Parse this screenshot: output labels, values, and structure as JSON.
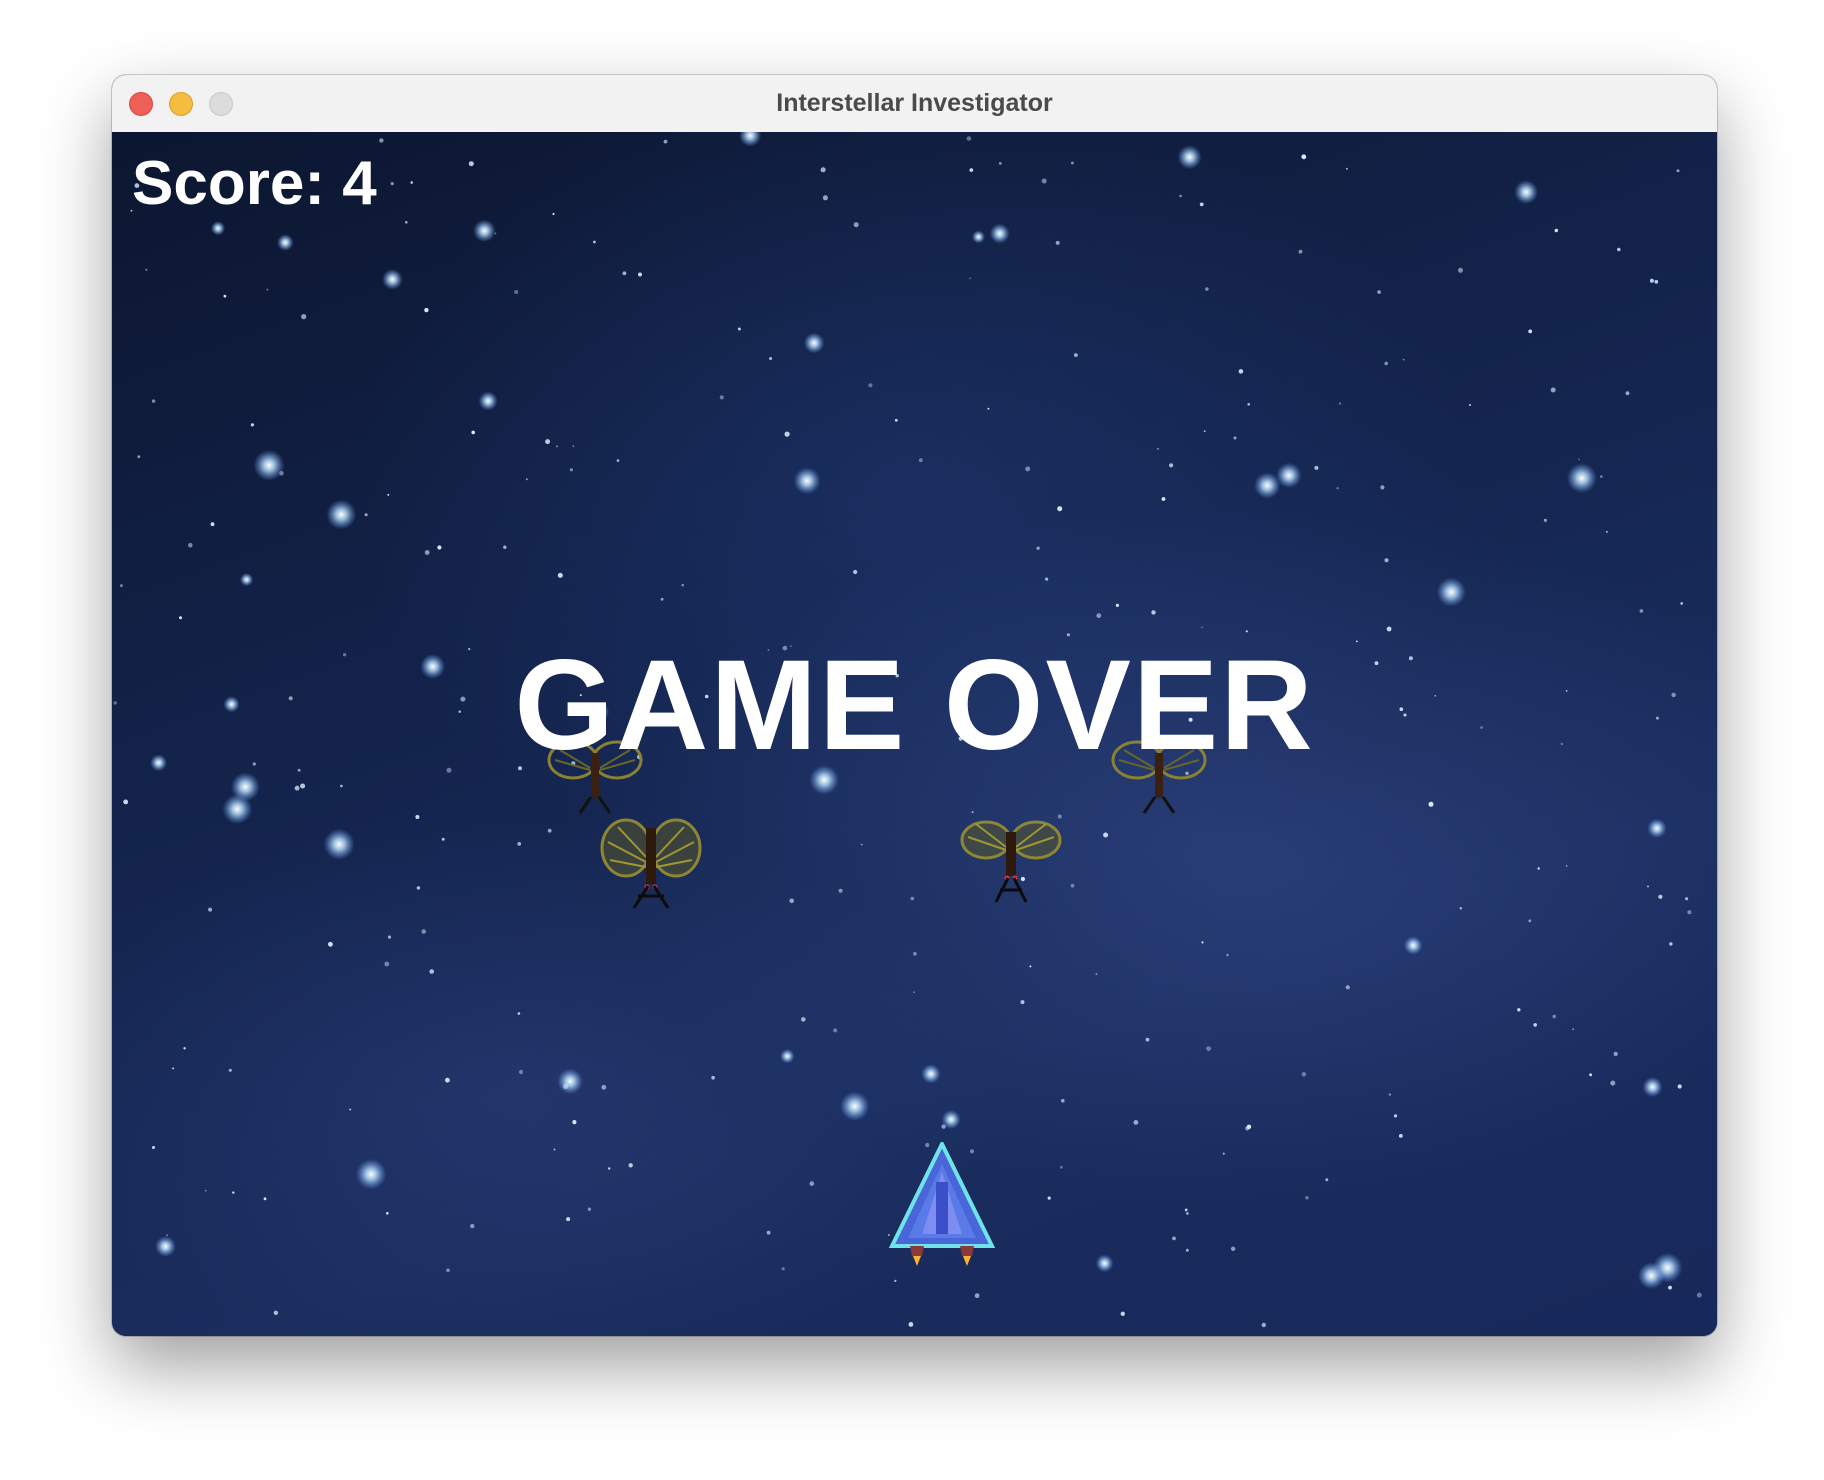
{
  "window": {
    "title": "Interstellar Investigator"
  },
  "hud": {
    "score_label": "Score: 4",
    "score": 4
  },
  "overlay": {
    "message": "GAME OVER"
  },
  "sprites": {
    "enemies": [
      "moth-enemy",
      "moth-enemy",
      "moth-enemy",
      "moth-enemy"
    ],
    "player": "player-spaceship"
  },
  "colors": {
    "background": "#14254f",
    "moth_wing": "#7a7330",
    "ship_body": "#4f6fe0",
    "ship_outline": "#6fe3e8"
  }
}
